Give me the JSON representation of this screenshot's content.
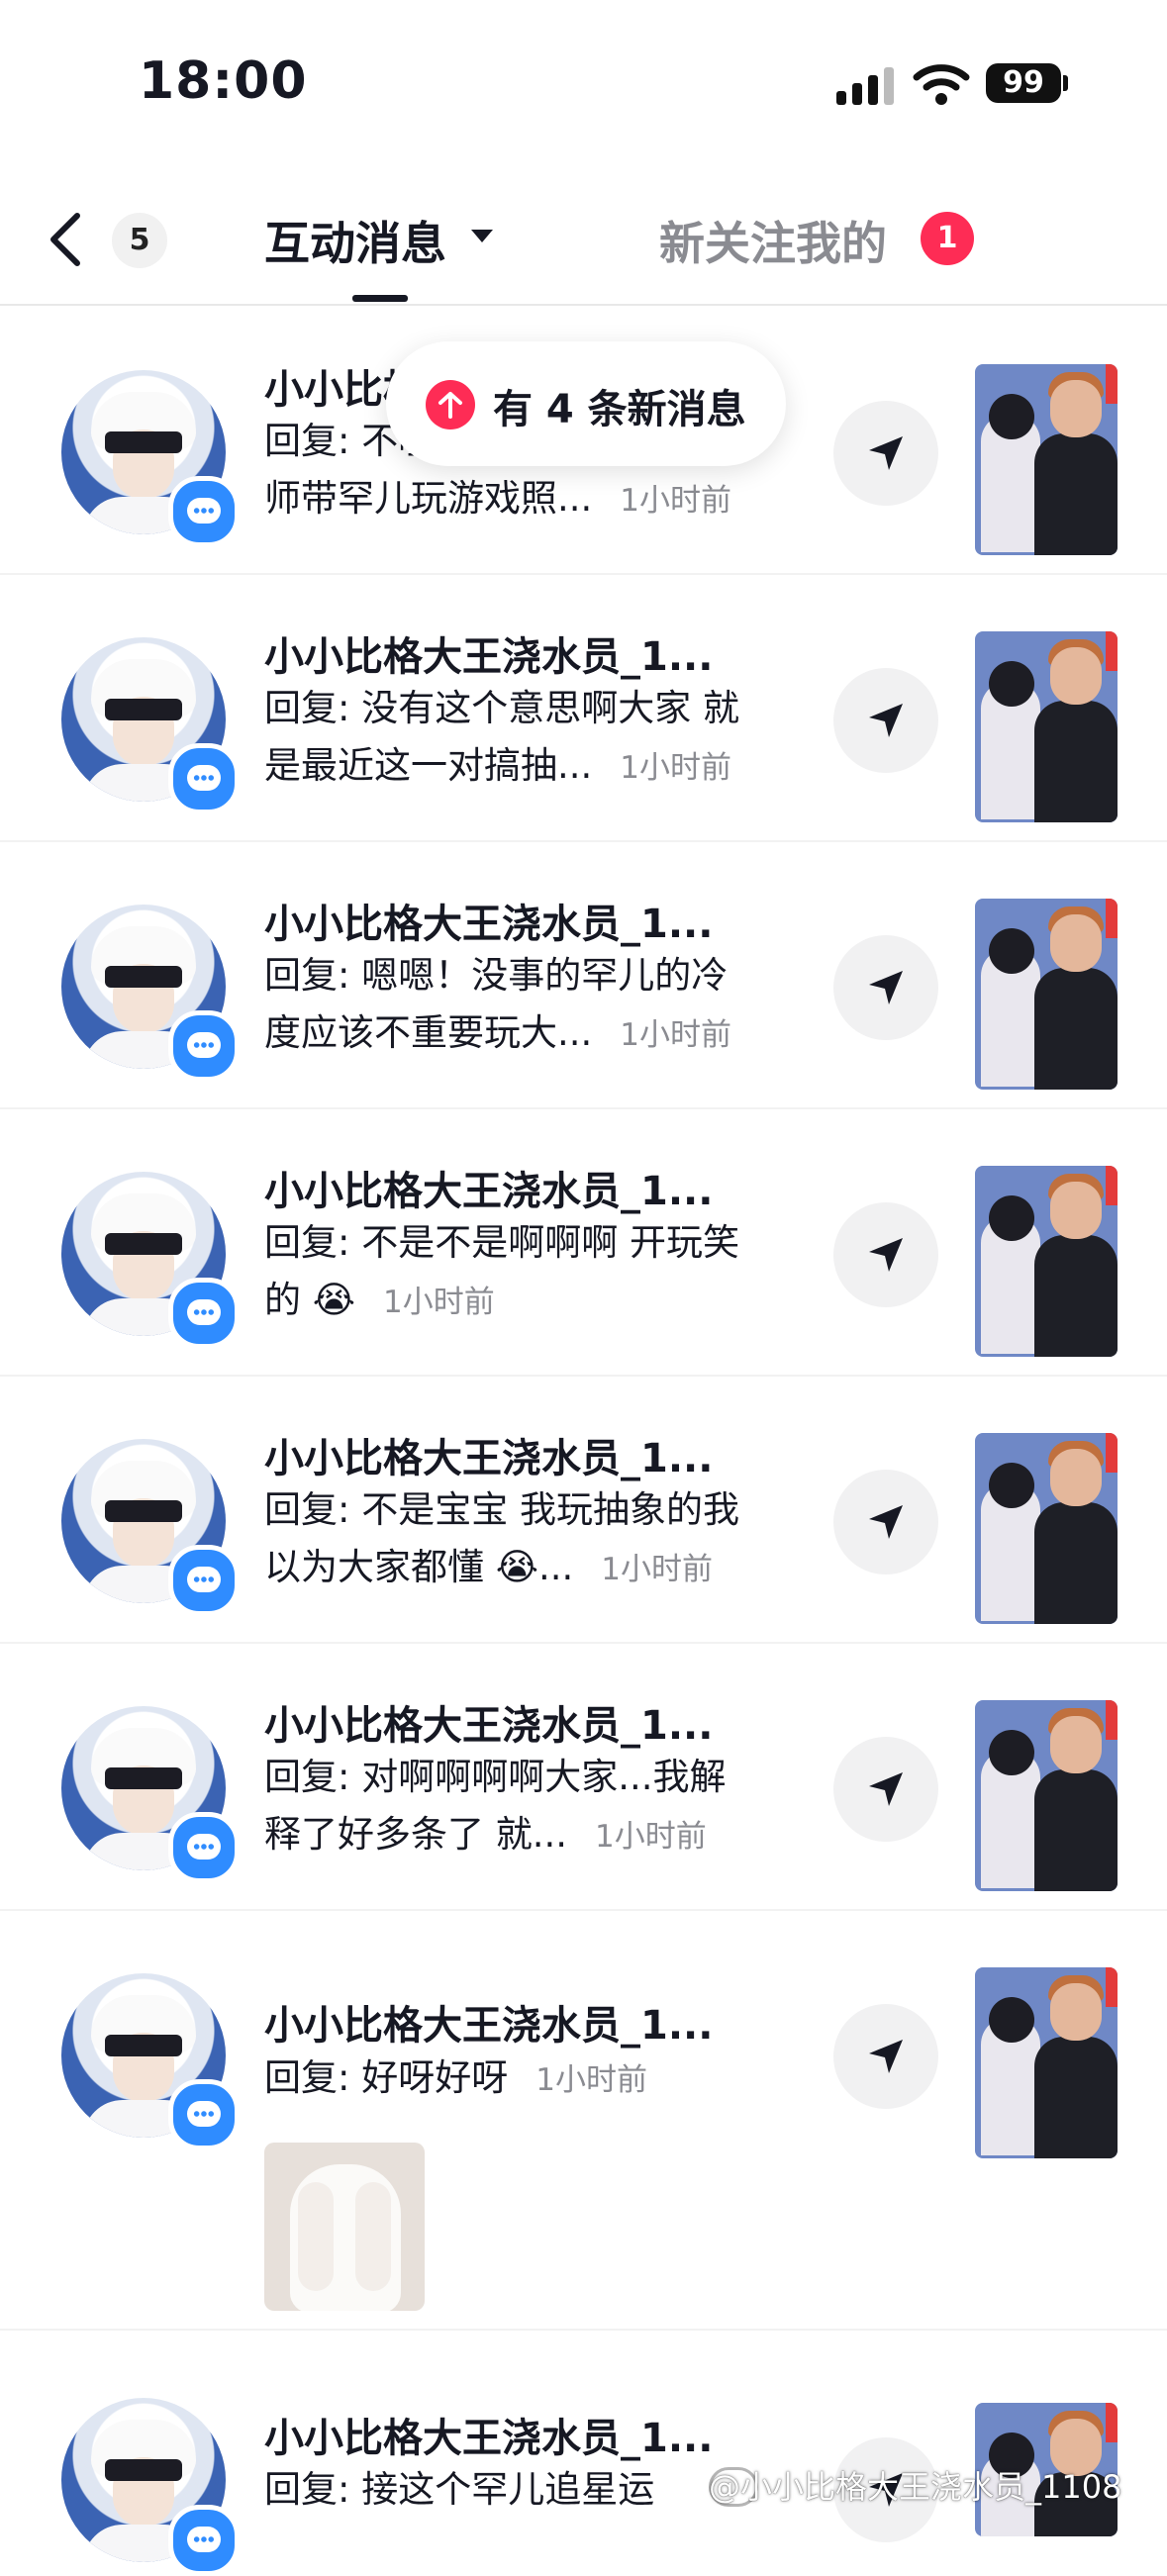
{
  "status_bar": {
    "time": "18:00",
    "battery": "99"
  },
  "nav": {
    "back_count": "5",
    "tab_active": "互动消息",
    "tab_other": "新关注我的",
    "tab_other_badge": "1"
  },
  "toast": {
    "text": "有 4 条新消息"
  },
  "messages": [
    {
      "name": "小小比格大王浇水员_1...",
      "line1": "回复: 不嗑不嗑 谢谢黄子陪老",
      "line2": "师带罕儿玩游戏照...",
      "time": "1小时前"
    },
    {
      "name": "小小比格大王浇水员_1...",
      "line1": "回复: 没有这个意思啊大家 就",
      "line2": "是最近这一对搞抽...",
      "time": "1小时前"
    },
    {
      "name": "小小比格大王浇水员_1...",
      "line1": "回复: 嗯嗯！没事的罕儿的冷",
      "line2": "度应该不重要玩大...",
      "time": "1小时前"
    },
    {
      "name": "小小比格大王浇水员_1...",
      "line1": "回复: 不是不是啊啊啊 开玩笑",
      "line2": "的 😭",
      "time": "1小时前"
    },
    {
      "name": "小小比格大王浇水员_1...",
      "line1": "回复: 不是宝宝 我玩抽象的我",
      "line2": "以为大家都懂 😭...",
      "time": "1小时前"
    },
    {
      "name": "小小比格大王浇水员_1...",
      "line1": "回复: 对啊啊啊啊大家...我解",
      "line2": "释了好多条了 就...",
      "time": "1小时前"
    },
    {
      "name": "小小比格大王浇水员_1...",
      "line1": "回复: 好呀好呀",
      "line2": "",
      "time": "1小时前"
    },
    {
      "name": "小小比格大王浇水员_1...",
      "line1": "回复: 接这个罕儿追星运",
      "line2": "",
      "time": ""
    }
  ],
  "watermark": "@小小比格大王浇水员_1108",
  "icons": {
    "back": "chevron-left-icon",
    "send": "send-icon",
    "chat": "chat-bubble-icon",
    "up": "arrow-up-icon"
  },
  "colors": {
    "accent": "#fe2c55",
    "chat_badge": "#2f8cff",
    "muted_text": "#8a8b91"
  }
}
